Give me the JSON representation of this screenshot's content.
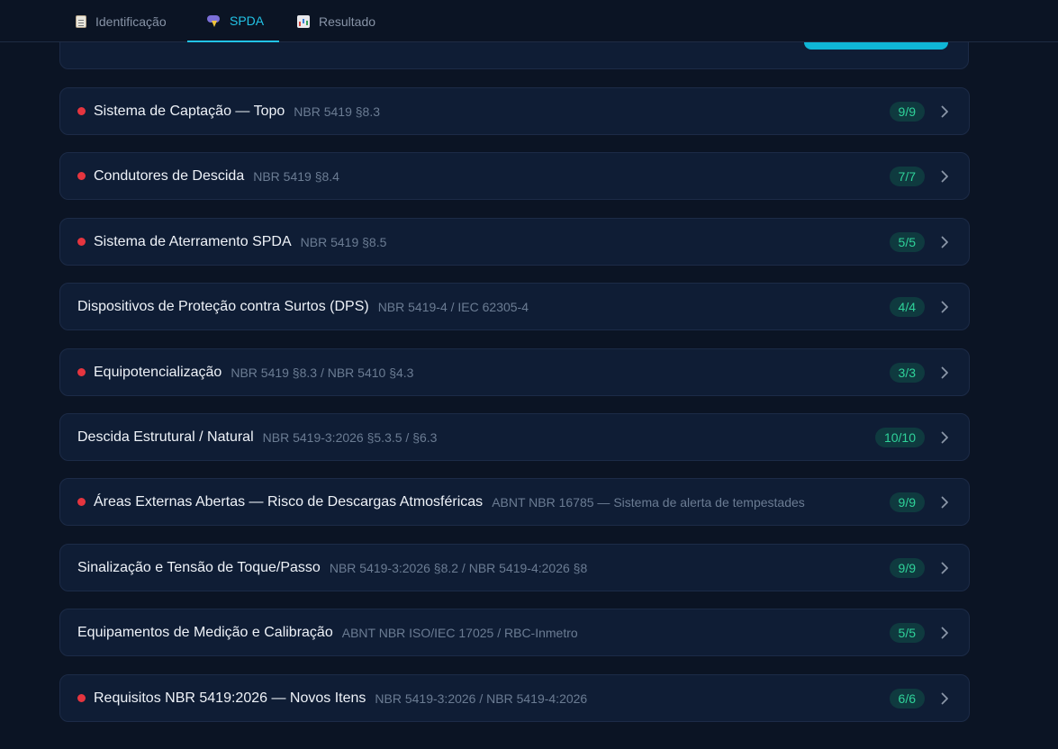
{
  "tabs": [
    {
      "label": "Identificação",
      "icon": "clipboard-icon",
      "active": false
    },
    {
      "label": "SPDA",
      "icon": "storm-icon",
      "active": true
    },
    {
      "label": "Resultado",
      "icon": "bar-chart-icon",
      "active": false
    }
  ],
  "colors": {
    "background": "#0b1424",
    "card": "#0f1d35",
    "accent": "#22c3e6",
    "alert_dot": "#e5353f",
    "badge_text": "#2fd39a"
  },
  "sections": [
    {
      "title": "Sistema de Captação — Topo",
      "ref": "NBR 5419 §8.3",
      "count": "9/9",
      "alert": true
    },
    {
      "title": "Condutores de Descida",
      "ref": "NBR 5419 §8.4",
      "count": "7/7",
      "alert": true
    },
    {
      "title": "Sistema de Aterramento SPDA",
      "ref": "NBR 5419 §8.5",
      "count": "5/5",
      "alert": true
    },
    {
      "title": "Dispositivos de Proteção contra Surtos (DPS)",
      "ref": "NBR 5419-4 / IEC 62305-4",
      "count": "4/4",
      "alert": false
    },
    {
      "title": "Equipotencialização",
      "ref": "NBR 5419 §8.3 / NBR 5410 §4.3",
      "count": "3/3",
      "alert": true
    },
    {
      "title": "Descida Estrutural / Natural",
      "ref": "NBR 5419-3:2026 §5.3.5 / §6.3",
      "count": "10/10",
      "alert": false
    },
    {
      "title": "Áreas Externas Abertas — Risco de Descargas Atmosféricas",
      "ref": "ABNT NBR 16785 — Sistema de alerta de tempestades",
      "count": "9/9",
      "alert": true
    },
    {
      "title": "Sinalização e Tensão de Toque/Passo",
      "ref": "NBR 5419-3:2026 §8.2 / NBR 5419-4:2026 §8",
      "count": "9/9",
      "alert": false
    },
    {
      "title": "Equipamentos de Medição e Calibração",
      "ref": "ABNT NBR ISO/IEC 17025 / RBC-Inmetro",
      "count": "5/5",
      "alert": false
    },
    {
      "title": "Requisitos NBR 5419:2026 — Novos Itens",
      "ref": "NBR 5419-3:2026 / NBR 5419-4:2026",
      "count": "6/6",
      "alert": true
    }
  ]
}
